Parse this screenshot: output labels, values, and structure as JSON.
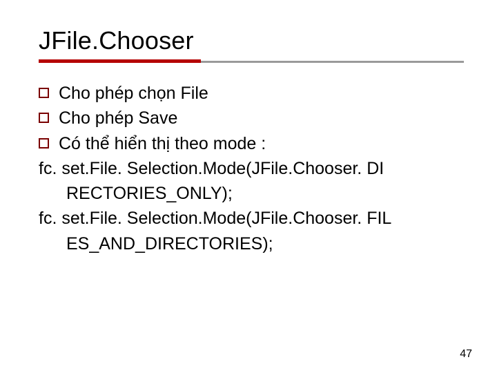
{
  "title": "JFile.Chooser",
  "bullets": [
    "Cho phép chọn File",
    "Cho phép Save",
    "Có thể hiển thị theo mode :"
  ],
  "code": {
    "line1a": "fc. set.File. Selection.Mode(JFile.Chooser. DI",
    "line1b": "RECTORIES_ONLY);",
    "line2a": "fc. set.File. Selection.Mode(JFile.Chooser. FIL",
    "line2b": "ES_AND_DIRECTORIES);"
  },
  "page_number": "47"
}
